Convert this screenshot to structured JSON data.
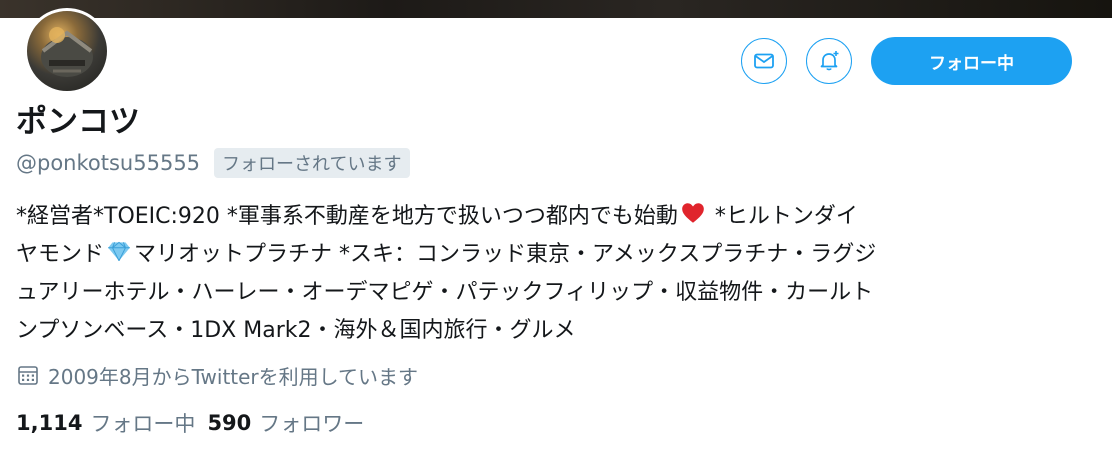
{
  "profile": {
    "name": "ポンコツ",
    "handle": "@ponkotsu55555",
    "follows_you_badge": "フォローされています",
    "follow_button_label": "フォロー中"
  },
  "bio": {
    "line1_a": "*経営者*TOEIC:920 *軍事系不動産を地方で扱いつつ都内でも始動",
    "line1_b": " *ヒルトンダイ",
    "line2_a": "ヤモンド",
    "line2_b": "マリオットプラチナ *スキ：コンラッド東京・アメックスプラチナ・ラグジ",
    "line3": "ュアリーホテル・ハーレー・オーデマピゲ・パテックフィリップ・収益物件・カールト",
    "line4": "ンプソンベース・1DX Mark2・海外＆国内旅行・グルメ"
  },
  "joined_text": "2009年8月からTwitterを利用しています",
  "stats": {
    "following_count": "1,114",
    "following_label": "フォロー中",
    "followers_count": "590",
    "followers_label": "フォロワー"
  },
  "icons": {
    "mail": "mail-icon",
    "bell": "notification-bell-plus-icon",
    "calendar": "calendar-icon",
    "heart": "red-heart-emoji",
    "gem": "gem-emoji"
  },
  "colors": {
    "accent": "#1da1f2",
    "secondary_text": "#657786",
    "badge_bg": "#e6ecf0"
  }
}
